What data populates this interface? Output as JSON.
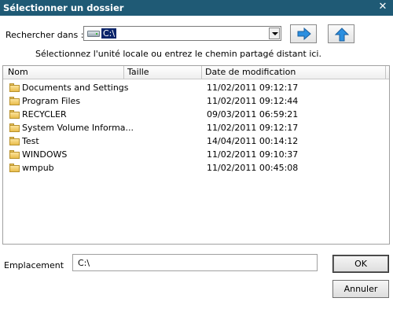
{
  "window": {
    "title": "Sélectionner un dossier",
    "close_glyph": "✕"
  },
  "lookin": {
    "label": "Rechercher dans :",
    "value": "C:\\"
  },
  "hint": "Sélectionnez l'unité locale ou entrez le chemin partagé distant ici.",
  "columns": {
    "name": "Nom",
    "size": "Taille",
    "date": "Date de modification"
  },
  "rows": [
    {
      "name": "Documents and Settings",
      "date": "11/02/2011 09:12:17"
    },
    {
      "name": "Program Files",
      "date": "11/02/2011 09:12:44"
    },
    {
      "name": "RECYCLER",
      "date": "09/03/2011 06:59:21"
    },
    {
      "name": "System Volume Informa...",
      "date": "11/02/2011 09:12:17"
    },
    {
      "name": "Test",
      "date": "14/04/2011 00:14:12"
    },
    {
      "name": "WINDOWS",
      "date": "11/02/2011 09:10:37"
    },
    {
      "name": "wmpub",
      "date": "11/02/2011 00:45:08"
    }
  ],
  "location": {
    "label": "Emplacement",
    "value": "C:\\"
  },
  "buttons": {
    "ok": "OK",
    "cancel": "Annuler"
  },
  "icons": {
    "go": "arrow-right-icon",
    "up": "arrow-up-icon",
    "drive": "drive-icon",
    "folder": "folder-icon"
  },
  "colors": {
    "titlebar": "#1f5a75",
    "arrow_fill": "#2b8fe0",
    "selection": "#0a246a"
  }
}
